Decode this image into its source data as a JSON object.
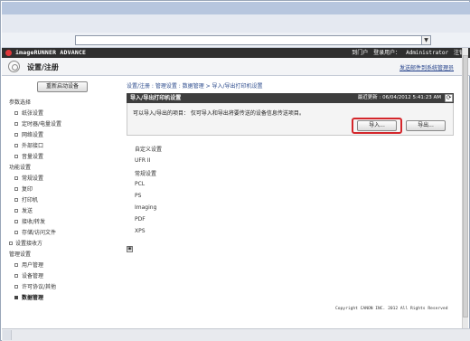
{
  "browser": {
    "address_dropdown": "▼"
  },
  "header": {
    "product": "imageRUNNER ADVANCE",
    "portal_link": "到门户",
    "login_label": "登录用户：",
    "user": "Administrator",
    "logout": "注销"
  },
  "page": {
    "title": "设置/注册",
    "mail_link": "发送邮件到系统管理员"
  },
  "sidebar": {
    "restart_button": "重新启动设备",
    "groups": [
      {
        "label": "参数选择",
        "items": [
          "纸张设置",
          "定时器/电量设置",
          "网络设置",
          "外部接口",
          "音量设置"
        ]
      },
      {
        "label": "功能设置",
        "items": [
          "常规设置",
          "复印",
          "打印机",
          "发送",
          "接收/转发",
          "存储/访问文件"
        ]
      }
    ],
    "receiver_settings": "设置接收方",
    "management": {
      "label": "管理设置",
      "items": [
        "用户管理",
        "设备管理",
        "许可协议/其他",
        "数据管理"
      ],
      "active": "数据管理"
    }
  },
  "content": {
    "breadcrumb": "设置/注册 : 管理设置 : 数据管理 > 导入/导出打印机设置",
    "section_title": "导入/导出打印机设置",
    "last_update": "最近更新 : 06/04/2012 5:41:23 AM",
    "info_text": "可以导入/导出的项目： 仅可导入和导出将要传送的设备信息传送项目。",
    "import_button": "导入...",
    "export_button": "导出...",
    "settings_list": [
      "自定义设置",
      "UFR II",
      "常规设置",
      "PCL",
      "PS",
      "Imaging",
      "PDF",
      "XPS"
    ],
    "copyright": "Copyright CANON INC. 2012 All Rights Reserved"
  },
  "icons": {
    "refresh": "refresh-icon",
    "gear": "gear-icon",
    "expand": "expand-icon",
    "logo": "logo-icon"
  },
  "colors": {
    "header_bg": "#2f2f2f",
    "section_bg": "#3d3d3d",
    "highlight": "#d4262b",
    "link": "#1f3d88"
  }
}
